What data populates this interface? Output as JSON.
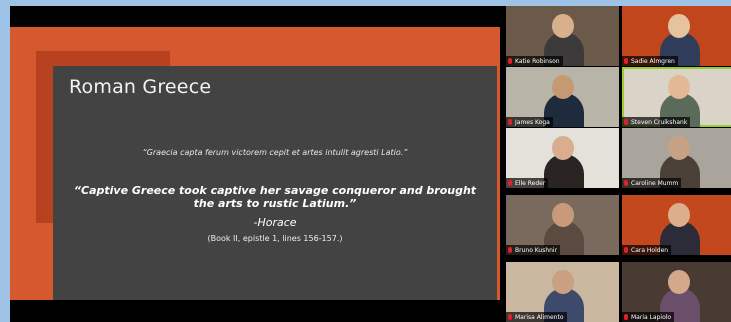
{
  "slide": {
    "title": "Roman Greece",
    "latin_quote": "“Graecia capta ferum victorem cepit et artes intulit agresti Latio.”",
    "english_quote_line1": "“Captive Greece took captive her savage conqueror and brought",
    "english_quote_line2": "the arts to rustic Latium.”",
    "author": "-Horace",
    "citation": "(Book II, epistle 1, lines 156-157.)"
  },
  "participants": [
    {
      "name": "Katie Robinson"
    },
    {
      "name": "Sadie Almgren"
    },
    {
      "name": "James Koga"
    },
    {
      "name": "Steven Cruikshank"
    },
    {
      "name": "Elle Reder"
    },
    {
      "name": "Caroline Mumm"
    },
    {
      "name": "Bruno Kushnir"
    },
    {
      "name": "Cara Holden"
    },
    {
      "name": "Marisa Alimento"
    },
    {
      "name": "Maria Lapiolo"
    }
  ],
  "colors": {
    "background": "#9ec3e6",
    "slide_orange": "#d6582e",
    "slide_dark_orange": "#b84220",
    "slide_panel": "#434343",
    "active_speaker_border": "#9acd32",
    "mic_muted": "#e0202a"
  }
}
